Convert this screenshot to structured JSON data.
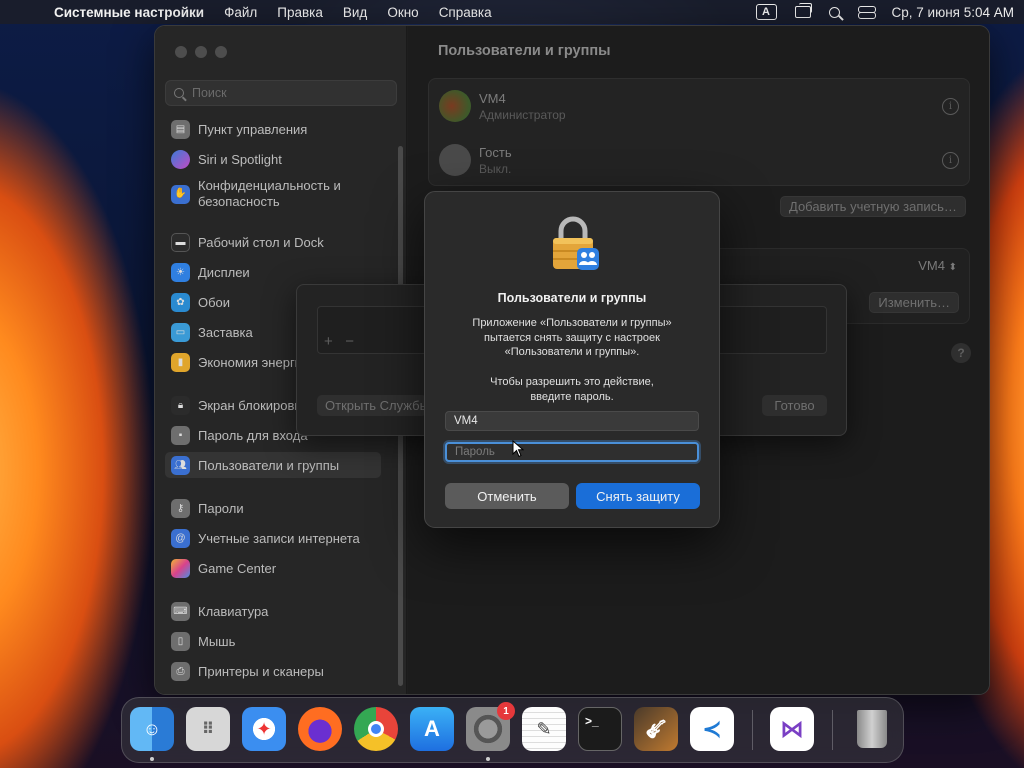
{
  "menubar": {
    "apple": "",
    "app_name": "Системные настройки",
    "items": [
      "Файл",
      "Правка",
      "Вид",
      "Окно",
      "Справка"
    ],
    "input_source": "A",
    "datetime": "Ср, 7 июня  5:04 AM"
  },
  "sidebar": {
    "search_placeholder": "Поиск",
    "items": [
      {
        "label": "Пункт управления",
        "icon": "control-center-icon",
        "color": "#6e6e6e"
      },
      {
        "label": "Siri и Spotlight",
        "icon": "siri-icon",
        "color": "#8b4cc9"
      },
      {
        "label": "Конфиденциальность и безопасность",
        "icon": "hand-icon",
        "color": "#3a6fd0"
      },
      {
        "label": "Рабочий стол и Dock",
        "icon": "dock-icon",
        "color": "#2b2b2b"
      },
      {
        "label": "Дисплеи",
        "icon": "sun-icon",
        "color": "#2f7fe0"
      },
      {
        "label": "Обои",
        "icon": "flower-icon",
        "color": "#2a8ad0"
      },
      {
        "label": "Заставка",
        "icon": "screensaver-icon",
        "color": "#3a9ad6"
      },
      {
        "label": "Экономия энергии",
        "icon": "battery-icon",
        "color": "#e0a52b"
      },
      {
        "label": "Экран блокировки",
        "icon": "lock-screen-icon",
        "color": "#2b2b2b"
      },
      {
        "label": "Пароль для входа",
        "icon": "lock-icon",
        "color": "#6e6e6e"
      },
      {
        "label": "Пользователи и группы",
        "icon": "users-icon",
        "color": "#3a6fd0"
      },
      {
        "label": "Пароли",
        "icon": "key-icon",
        "color": "#6e6e6e"
      },
      {
        "label": "Учетные записи интернета",
        "icon": "at-icon",
        "color": "#3a6fd0"
      },
      {
        "label": "Game Center",
        "icon": "game-center-icon",
        "color": "#c94b8a"
      },
      {
        "label": "Клавиатура",
        "icon": "keyboard-icon",
        "color": "#6e6e6e"
      },
      {
        "label": "Мышь",
        "icon": "mouse-icon",
        "color": "#6e6e6e"
      },
      {
        "label": "Принтеры и сканеры",
        "icon": "printer-icon",
        "color": "#6e6e6e"
      }
    ]
  },
  "content": {
    "title": "Пользователи и группы",
    "users": [
      {
        "name": "VM4",
        "role": "Администратор"
      },
      {
        "name": "Гость",
        "role": "Выкл."
      }
    ],
    "add_account": "Добавить учетную запись…",
    "auto_login_value": "VM4",
    "edit_button": "Изменить…",
    "help": "?"
  },
  "sheet": {
    "add": "+",
    "remove": "−",
    "open_button": "Открыть Службы",
    "done_button": "Готово"
  },
  "dialog": {
    "title": "Пользователи и группы",
    "message_line1": "Приложение «Пользователи и группы»",
    "message_line2": "пытается снять защиту с настроек",
    "message_line3": "«Пользователи и группы».",
    "prompt_line1": "Чтобы разрешить это действие,",
    "prompt_line2": "введите пароль.",
    "username_value": "VM4",
    "password_placeholder": "Пароль",
    "cancel": "Отменить",
    "unlock": "Снять защиту"
  },
  "dock": {
    "settings_badge": "1",
    "apps": [
      "finder-icon",
      "launchpad-icon",
      "safari-icon",
      "firefox-icon",
      "chrome-icon",
      "app-store-icon",
      "system-settings-icon",
      "textedit-icon",
      "terminal-icon",
      "garageband-icon",
      "vscode-icon",
      "visual-studio-icon",
      "trash-icon"
    ]
  }
}
